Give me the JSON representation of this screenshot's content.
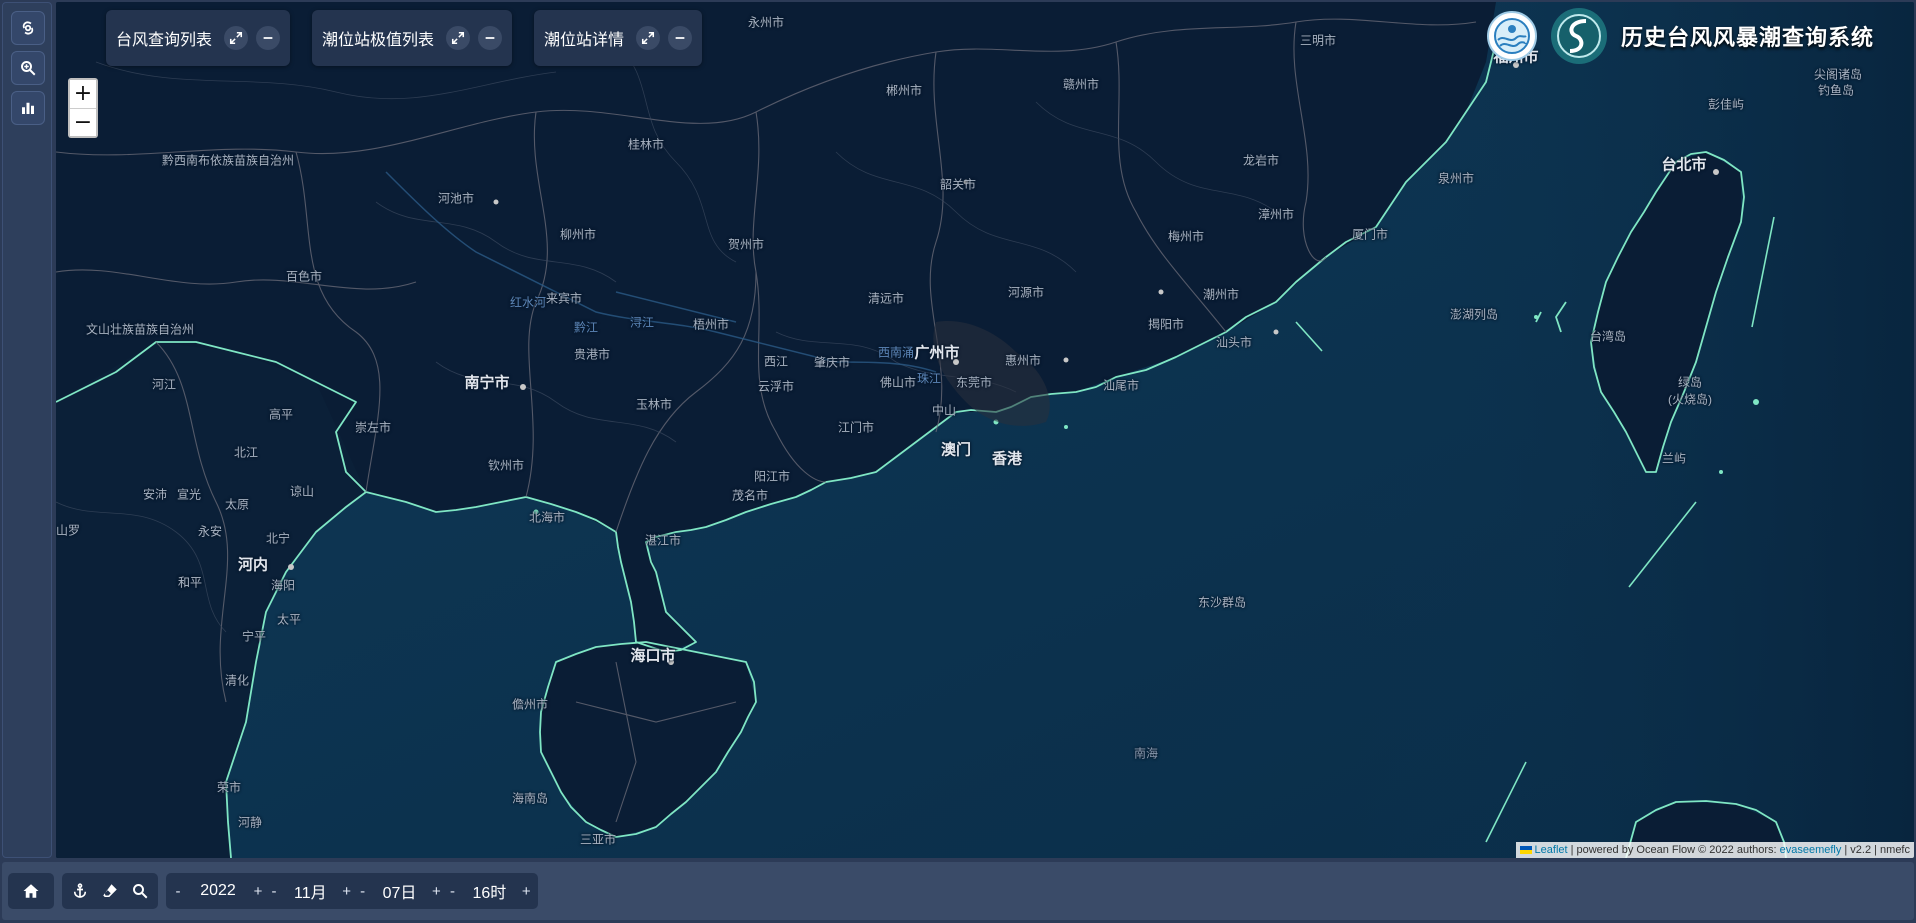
{
  "app": {
    "title": "历史台风风暴潮查询系统"
  },
  "panels": [
    {
      "label": "台风查询列表"
    },
    {
      "label": "潮位站极值列表"
    },
    {
      "label": "潮位站详情"
    }
  ],
  "zoom": {
    "in": "+",
    "out": "−"
  },
  "attribution": {
    "leaflet": "Leaflet",
    "powered": "| powered by Ocean Flow © 2022 authors:",
    "author": "evaseemefly",
    "version": "| v2.2 | nmefc"
  },
  "time": {
    "year": "2022",
    "month": "11月",
    "day": "07日",
    "hour": "16时",
    "minus": "-",
    "plus": "+"
  },
  "icons": {
    "rail": [
      "typhoon-icon",
      "search-zoom-icon",
      "bar-chart-icon"
    ],
    "panel": [
      "expand-icon",
      "minimize-icon"
    ],
    "toolbar": [
      "home-icon",
      "anchor-icon",
      "eraser-icon",
      "search-zoom-icon"
    ]
  },
  "colors": {
    "coastline": "#7fe6c4",
    "sea": "#0c3550",
    "land": "#0a1c33",
    "panel": "#24344f",
    "toolbar": "#3a4b68"
  },
  "map": {
    "labels": [
      {
        "t": "永州市",
        "c": ""
      },
      {
        "t": "三明市",
        "c": ""
      },
      {
        "t": "福州市",
        "c": "big"
      },
      {
        "t": "郴州市",
        "c": ""
      },
      {
        "t": "赣州市",
        "c": ""
      },
      {
        "t": "桂林市",
        "c": ""
      },
      {
        "t": "龙岩市",
        "c": ""
      },
      {
        "t": "泉州市",
        "c": ""
      },
      {
        "t": "黔西南布依族苗族自治州",
        "c": ""
      },
      {
        "t": "韶关市",
        "c": ""
      },
      {
        "t": "台北市",
        "c": "big"
      },
      {
        "t": "河池市",
        "c": ""
      },
      {
        "t": "柳州市",
        "c": ""
      },
      {
        "t": "漳州市",
        "c": ""
      },
      {
        "t": "梅州市",
        "c": ""
      },
      {
        "t": "厦门市",
        "c": ""
      },
      {
        "t": "贺州市",
        "c": ""
      },
      {
        "t": "百色市",
        "c": ""
      },
      {
        "t": "清远市",
        "c": ""
      },
      {
        "t": "河源市",
        "c": ""
      },
      {
        "t": "潮州市",
        "c": ""
      },
      {
        "t": "红水河",
        "c": "river"
      },
      {
        "t": "来宾市",
        "c": ""
      },
      {
        "t": "澎湖列岛",
        "c": ""
      },
      {
        "t": "揭阳市",
        "c": ""
      },
      {
        "t": "汕头市",
        "c": ""
      },
      {
        "t": "黔江",
        "c": "river"
      },
      {
        "t": "浔江",
        "c": "river"
      },
      {
        "t": "梧州市",
        "c": ""
      },
      {
        "t": "文山壮族苗族自治州",
        "c": ""
      },
      {
        "t": "广州市",
        "c": "big"
      },
      {
        "t": "台湾岛",
        "c": ""
      },
      {
        "t": "西南涌",
        "c": "river"
      },
      {
        "t": "贵港市",
        "c": ""
      },
      {
        "t": "西江",
        "c": ""
      },
      {
        "t": "肇庆市",
        "c": ""
      },
      {
        "t": "惠州市",
        "c": ""
      },
      {
        "t": "南宁市",
        "c": "big"
      },
      {
        "t": "云浮市",
        "c": ""
      },
      {
        "t": "佛山市",
        "c": ""
      },
      {
        "t": "珠江",
        "c": "river"
      },
      {
        "t": "东莞市",
        "c": ""
      },
      {
        "t": "汕尾市",
        "c": ""
      },
      {
        "t": "绿岛",
        "c": ""
      },
      {
        "t": "(火烧岛)",
        "c": ""
      },
      {
        "t": "河江",
        "c": ""
      },
      {
        "t": "玉林市",
        "c": ""
      },
      {
        "t": "高平",
        "c": ""
      },
      {
        "t": "崇左市",
        "c": ""
      },
      {
        "t": "江门市",
        "c": ""
      },
      {
        "t": "中山",
        "c": ""
      },
      {
        "t": "北江",
        "c": ""
      },
      {
        "t": "澳门",
        "c": "big"
      },
      {
        "t": "香港",
        "c": "big"
      },
      {
        "t": "钦州市",
        "c": ""
      },
      {
        "t": "兰屿",
        "c": ""
      },
      {
        "t": "宣光",
        "c": ""
      },
      {
        "t": "安沛",
        "c": ""
      },
      {
        "t": "谅山",
        "c": ""
      },
      {
        "t": "阳江市",
        "c": ""
      },
      {
        "t": "太原",
        "c": ""
      },
      {
        "t": "茂名市",
        "c": ""
      },
      {
        "t": "北海市",
        "c": ""
      },
      {
        "t": "永安",
        "c": ""
      },
      {
        "t": "北宁",
        "c": ""
      },
      {
        "t": "山罗",
        "c": ""
      },
      {
        "t": "湛江市",
        "c": ""
      },
      {
        "t": "河内",
        "c": "big"
      },
      {
        "t": "和平",
        "c": ""
      },
      {
        "t": "海阳",
        "c": ""
      },
      {
        "t": "东沙群岛",
        "c": ""
      },
      {
        "t": "太平",
        "c": ""
      },
      {
        "t": "宁平",
        "c": ""
      },
      {
        "t": "海口市",
        "c": "big"
      },
      {
        "t": "清化",
        "c": ""
      },
      {
        "t": "儋州市",
        "c": ""
      },
      {
        "t": "南海",
        "c": "sea"
      },
      {
        "t": "荣市",
        "c": ""
      },
      {
        "t": "海南岛",
        "c": ""
      },
      {
        "t": "河静",
        "c": ""
      },
      {
        "t": "三亚市",
        "c": ""
      },
      {
        "t": "尖阁诸岛",
        "c": ""
      },
      {
        "t": "钓鱼岛",
        "c": ""
      },
      {
        "t": "彭佳屿",
        "c": ""
      },
      {
        "t": "和平",
        "c": ""
      }
    ]
  }
}
